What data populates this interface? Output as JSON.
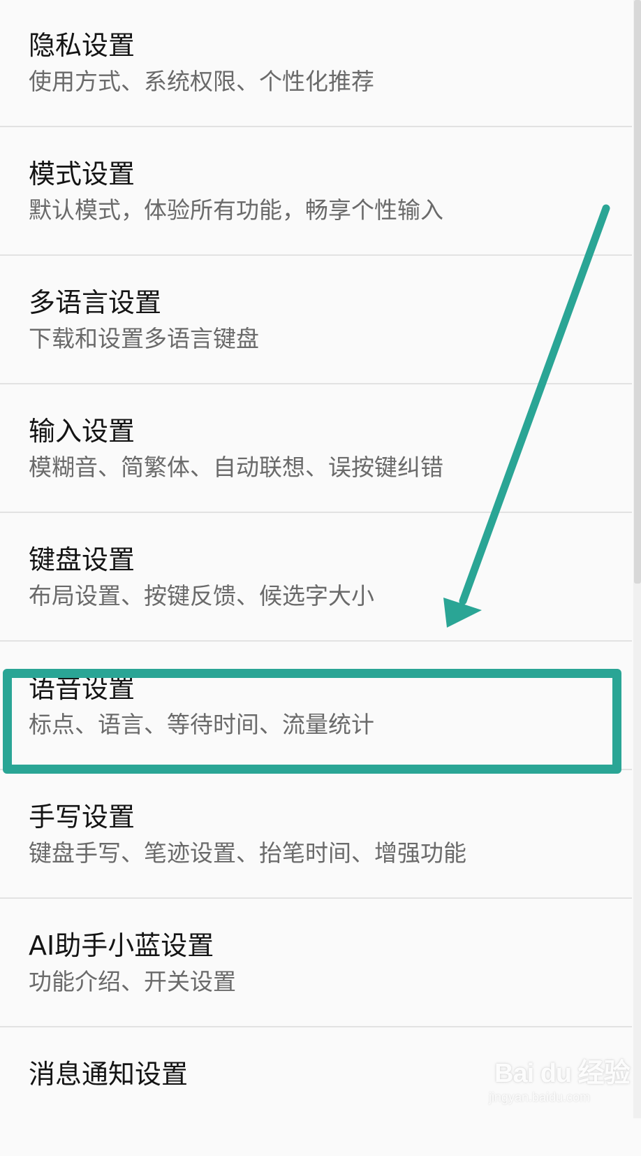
{
  "settings": {
    "items": [
      {
        "title": "隐私设置",
        "subtitle": "使用方式、系统权限、个性化推荐"
      },
      {
        "title": "模式设置",
        "subtitle": "默认模式，体验所有功能，畅享个性输入"
      },
      {
        "title": "多语言设置",
        "subtitle": "下载和设置多语言键盘"
      },
      {
        "title": "输入设置",
        "subtitle": "模糊音、简繁体、自动联想、误按键纠错"
      },
      {
        "title": "键盘设置",
        "subtitle": "布局设置、按键反馈、候选字大小"
      },
      {
        "title": "语音设置",
        "subtitle": "标点、语言、等待时间、流量统计"
      },
      {
        "title": "手写设置",
        "subtitle": "键盘手写、笔迹设置、抬笔时间、增强功能"
      },
      {
        "title": "AI助手小蓝设置",
        "subtitle": "功能介绍、开关设置"
      },
      {
        "title": "消息通知设置",
        "subtitle": ""
      }
    ]
  },
  "annotation": {
    "color": "#2aa595",
    "highlighted_item": "语音设置"
  },
  "watermark": {
    "logo": "Bai du 经验",
    "site": "jingyan.baidu.com"
  }
}
